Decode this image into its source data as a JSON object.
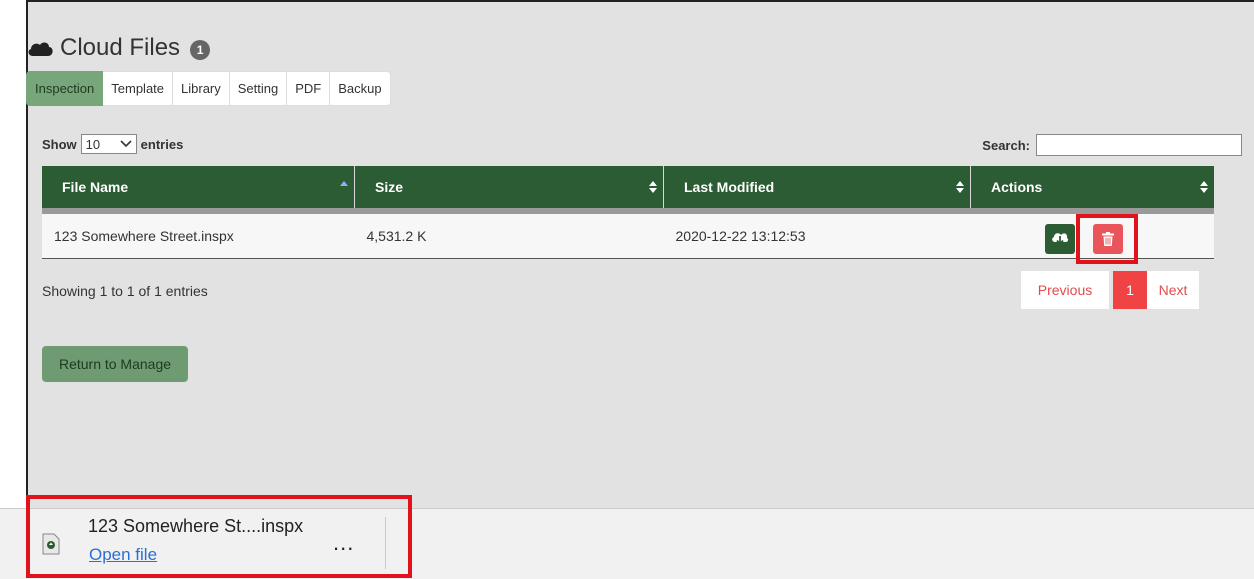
{
  "header": {
    "title": "Cloud Files",
    "badge": "1"
  },
  "tabs": [
    {
      "label": "Inspection",
      "active": true
    },
    {
      "label": "Template"
    },
    {
      "label": "Library"
    },
    {
      "label": "Setting"
    },
    {
      "label": "PDF"
    },
    {
      "label": "Backup"
    }
  ],
  "length_control": {
    "prefix": "Show",
    "value": "10",
    "suffix": "entries"
  },
  "search": {
    "label": "Search:",
    "value": ""
  },
  "table": {
    "columns": [
      "File Name",
      "Size",
      "Last Modified",
      "Actions"
    ],
    "rows": [
      {
        "file_name": "123 Somewhere Street.inspx",
        "size": "4,531.2 K",
        "last_modified": "2020-12-22 13:12:53"
      }
    ]
  },
  "info": "Showing 1 to 1 of 1 entries",
  "pagination": {
    "previous": "Previous",
    "current": "1",
    "next": "Next"
  },
  "return_button": "Return to Manage",
  "download_bar": {
    "file_name": "123 Somewhere St....inspx",
    "open_label": "Open file",
    "more": "..."
  },
  "colors": {
    "accent": "#2c5c33",
    "tab_active": "#76a67a",
    "danger": "#e9555a",
    "highlight": "#e0121b"
  }
}
